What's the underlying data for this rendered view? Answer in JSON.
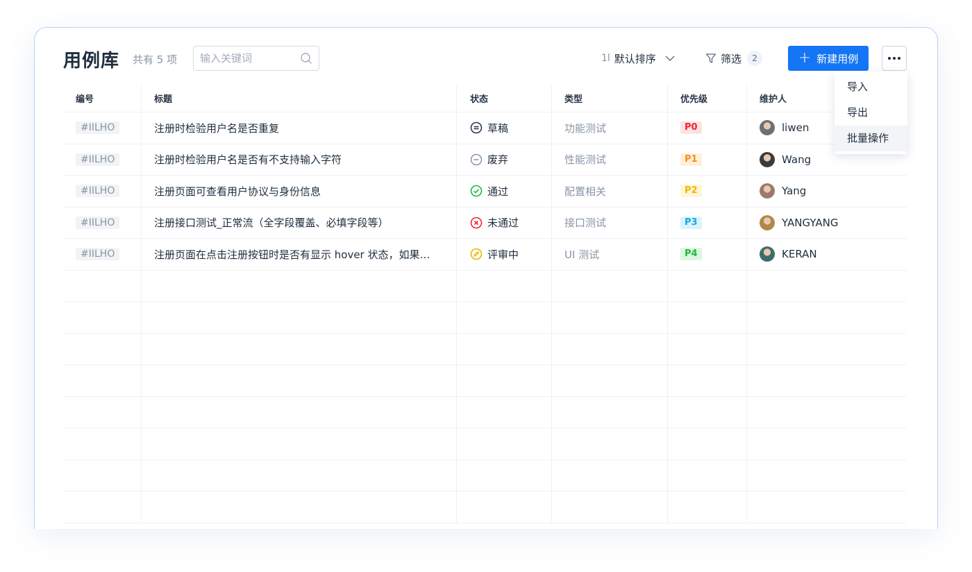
{
  "header": {
    "title": "用例库",
    "count": "共有 5 项",
    "search_placeholder": "输入关键词",
    "sort_glyph": "1l",
    "sort_label": "默认排序",
    "filter_label": "筛选",
    "filter_count": "2",
    "new_label": "新建用例"
  },
  "menu": {
    "items": [
      "导入",
      "导出",
      "批量操作"
    ],
    "active_index": 2
  },
  "table": {
    "columns": [
      "编号",
      "标题",
      "状态",
      "类型",
      "优先级",
      "维护人"
    ],
    "rows": [
      {
        "id": "#IILHO",
        "title": "注册时检验用户名是否重复",
        "status": "草稿",
        "status_icon": "draft-icon",
        "type": "功能测试",
        "priority": "P0",
        "maintainer": "liwen"
      },
      {
        "id": "#IILHO",
        "title": "注册时检验用户名是否有不支持输入字符",
        "status": "废弃",
        "status_icon": "abandoned-icon",
        "type": "性能测试",
        "priority": "P1",
        "maintainer": "Wang"
      },
      {
        "id": "#IILHO",
        "title": "注册页面可查看用户协议与身份信息",
        "status": "通过",
        "status_icon": "passed-icon",
        "type": "配置相关",
        "priority": "P2",
        "maintainer": "Yang"
      },
      {
        "id": "#IILHO",
        "title": "注册接口测试_正常流（全字段覆盖、必填字段等）",
        "status": "未通过",
        "status_icon": "failed-icon",
        "type": "接口测试",
        "priority": "P3",
        "maintainer": "YANGYANG"
      },
      {
        "id": "#IILHO",
        "title": "注册页面在点击注册按钮时是否有显示 hover 状态，如果…",
        "status": "评审中",
        "status_icon": "reviewing-icon",
        "type": "UI 测试",
        "priority": "P4",
        "maintainer": "KERAN"
      }
    ],
    "empty_rows": 8
  },
  "colors": {
    "primary": "#1475f5",
    "p0_bg": "#fde2e4",
    "p0_fg": "#f5222d",
    "p1_bg": "#fff0db",
    "p1_fg": "#fa8c16",
    "p2_bg": "#fff6d6",
    "p2_fg": "#f0b400",
    "p3_bg": "#dcf3fc",
    "p3_fg": "#13a8e0",
    "p4_bg": "#dcf7e0",
    "p4_fg": "#1fb83c",
    "draft": "#2a3547",
    "abandoned": "#8a94a6",
    "passed": "#1fb83c",
    "failed": "#f5222d",
    "reviewing": "#f0b400"
  }
}
